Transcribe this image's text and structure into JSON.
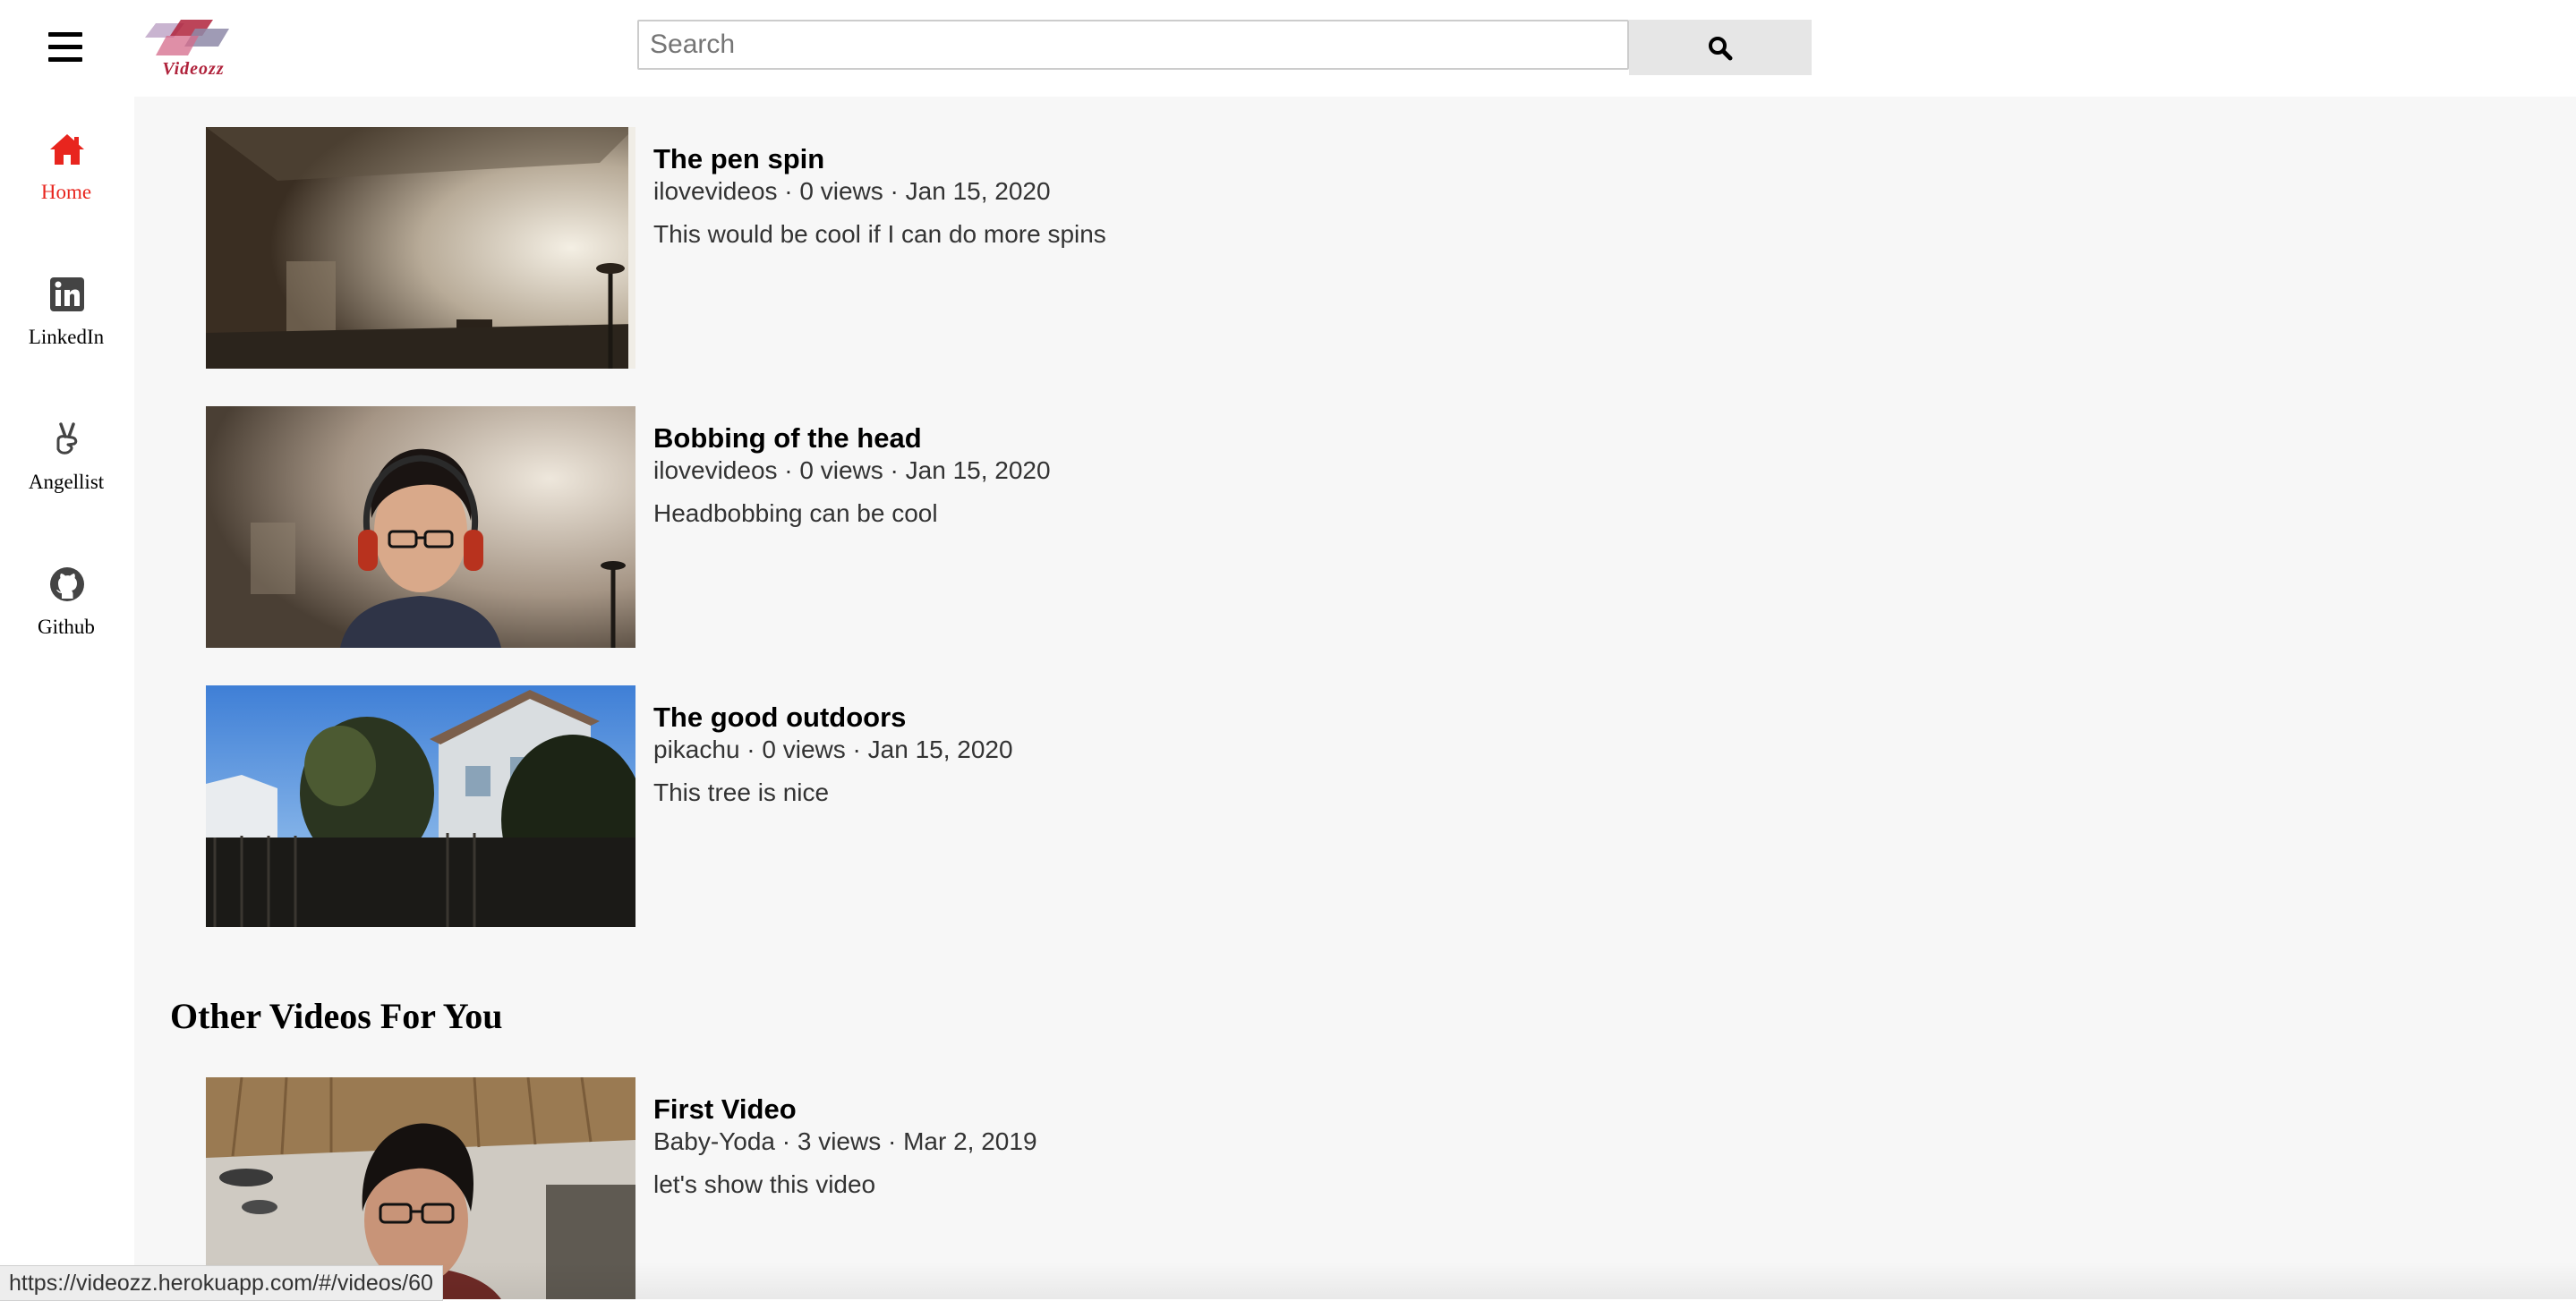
{
  "header": {
    "logo_text": "Videozz",
    "search_placeholder": "Search"
  },
  "sidebar": {
    "items": [
      {
        "label": "Home",
        "icon": "home-icon",
        "active": true
      },
      {
        "label": "LinkedIn",
        "icon": "linkedin-icon"
      },
      {
        "label": "Angellist",
        "icon": "angellist-icon"
      },
      {
        "label": "Github",
        "icon": "github-icon"
      }
    ]
  },
  "videos": [
    {
      "title": "The pen spin",
      "meta": "ilovevideos · 0 views · Jan 15, 2020",
      "description": "This would be cool if I can do more spins"
    },
    {
      "title": "Bobbing of the head",
      "meta": "ilovevideos · 0 views · Jan 15, 2020",
      "description": "Headbobbing can be cool"
    },
    {
      "title": "The good outdoors",
      "meta": "pikachu · 0 views · Jan 15, 2020",
      "description": "This tree is nice"
    }
  ],
  "other_section": {
    "heading": "Other Videos For You",
    "videos": [
      {
        "title": "First Video",
        "meta": "Baby-Yoda · 3 views · Mar 2, 2019",
        "description": "let's show this video"
      }
    ]
  },
  "status_bar": {
    "url": "https://videozz.herokuapp.com/#/videos/60"
  },
  "colors": {
    "accent": "#e8251e",
    "content_background": "#f7f7f7",
    "search_button": "#e6e6e6"
  }
}
